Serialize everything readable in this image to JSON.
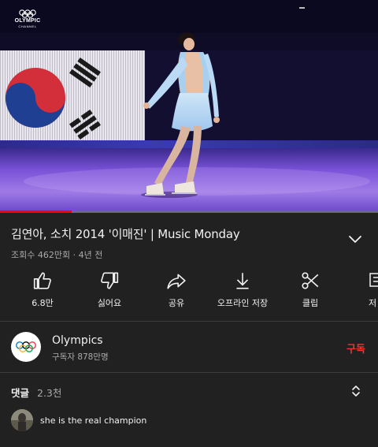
{
  "video": {
    "channel_logo_name": "OLYMPIC",
    "channel_logo_sub": "CHANNEL",
    "progress_percent": 19
  },
  "title": {
    "text": "김연아, 소치 2014 '이매진' | Music Monday",
    "meta": "조회수 462만회 · 4년 전"
  },
  "actions": [
    {
      "label": "6.8만",
      "icon": "thumbs-up-icon"
    },
    {
      "label": "싫어요",
      "icon": "thumbs-down-icon"
    },
    {
      "label": "공유",
      "icon": "share-icon"
    },
    {
      "label": "오프라인 저장",
      "icon": "download-icon"
    },
    {
      "label": "클립",
      "icon": "scissors-icon"
    },
    {
      "label": "저",
      "icon": "save-playlist-icon"
    }
  ],
  "channel": {
    "name": "Olympics",
    "subscribers": "구독자 878만명",
    "subscribe_label": "구독"
  },
  "comments": {
    "label": "댓글",
    "count": "2.3천",
    "first_comment": "she is the real champion"
  },
  "colors": {
    "background": "#212121",
    "progress": "#ff0000",
    "subscribe": "#e53935"
  }
}
